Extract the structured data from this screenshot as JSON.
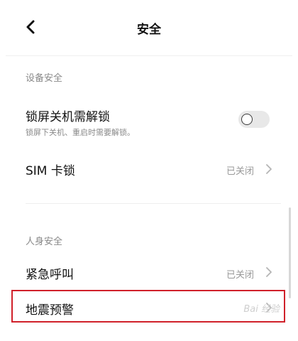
{
  "header": {
    "title": "安全",
    "back_icon": "chevron-left-icon"
  },
  "sections": [
    {
      "title": "设备安全",
      "items": [
        {
          "title": "锁屏关机需解锁",
          "subtitle": "锁屏下关机、重启时需要解锁。",
          "control": "toggle",
          "enabled": false
        },
        {
          "title": "SIM 卡锁",
          "value": "已关闭",
          "control": "chevron"
        }
      ]
    },
    {
      "title": "人身安全",
      "items": [
        {
          "title": "紧急呼叫",
          "value": "已关闭",
          "control": "chevron"
        },
        {
          "title": "地震预警",
          "control": "chevron"
        }
      ]
    }
  ],
  "highlight_color": "#d0202a",
  "watermark": "Bai 经验"
}
